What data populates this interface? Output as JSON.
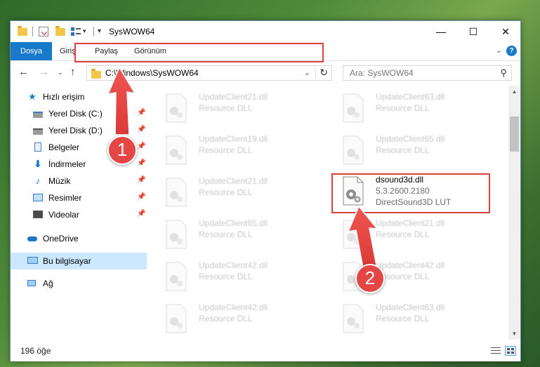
{
  "window": {
    "title": "SysWOW64",
    "controls": {
      "minimize": "—",
      "maximize": "☐",
      "close": "✕"
    }
  },
  "ribbon": {
    "tabs": [
      "Dosya",
      "Giriş",
      "Paylaş",
      "Görünüm"
    ],
    "help_glyph": "?"
  },
  "address": {
    "path": "C:\\Windows\\SysWOW64"
  },
  "search": {
    "placeholder": "Ara: SysWOW64"
  },
  "nav": {
    "quick_access": "Hızlı erişim",
    "items": [
      {
        "label": "Yerel Disk (C:)",
        "icon": "drive-icon"
      },
      {
        "label": "Yerel Disk (D:)",
        "icon": "drive-icon"
      },
      {
        "label": "Belgeler",
        "icon": "documents-icon"
      },
      {
        "label": "İndirmeler",
        "icon": "download-icon"
      },
      {
        "label": "Müzik",
        "icon": "music-icon"
      },
      {
        "label": "Resimler",
        "icon": "pictures-icon"
      },
      {
        "label": "Videolar",
        "icon": "videos-icon"
      }
    ],
    "onedrive": "OneDrive",
    "this_pc": "Bu bilgisayar",
    "network": "Ağ"
  },
  "files": {
    "left": [
      {
        "name": "UpdateClient21.dll",
        "desc": "Resource DLL"
      },
      {
        "name": "UpdateClient19.dll",
        "desc": "Resource DLL"
      },
      {
        "name": "UpdateClient21.dll",
        "desc": "Resource DLL"
      },
      {
        "name": "UpdateClient65.dll",
        "desc": "Resource DLL"
      },
      {
        "name": "UpdateClient42.dll",
        "desc": "Resource DLL"
      },
      {
        "name": "UpdateClient42.dll",
        "desc": "Resource DLL"
      }
    ],
    "right": [
      {
        "name": "UpdateClient63.dll",
        "desc": "Resource DLL"
      },
      {
        "name": "UpdateClient65.dll",
        "desc": "Resource DLL"
      },
      {
        "name": "UpdateClient21.dll",
        "desc": "Resource DLL"
      },
      {
        "name": "UpdateClient42.dll",
        "desc": "Resource DLL"
      },
      {
        "name": "UpdateClient63.dll",
        "desc": "Resource DLL"
      }
    ],
    "highlighted": {
      "name": "dsound3d.dll",
      "version": "5.3.2600.2180",
      "desc": "DirectSound3D LUT"
    }
  },
  "status": {
    "count": "196 öğe"
  },
  "annotations": {
    "badge1": "1",
    "badge2": "2",
    "color": "#e44743"
  }
}
